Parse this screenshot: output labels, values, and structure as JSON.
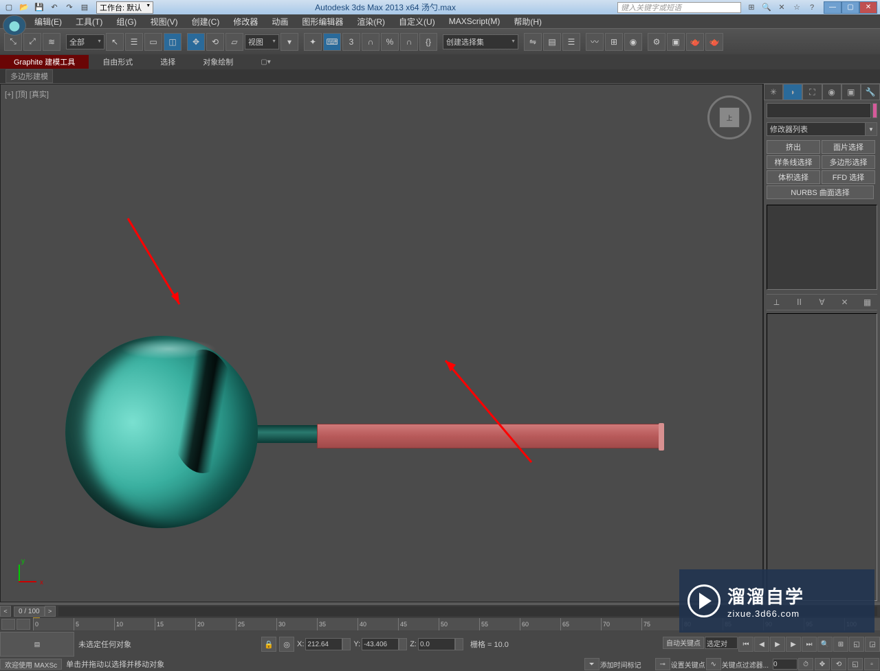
{
  "titlebar": {
    "workspace_label": "工作台: 默认",
    "app_title": "Autodesk 3ds Max  2013 x64     汤勺.max",
    "search_placeholder": "键入关键字或短语"
  },
  "menus": [
    "编辑(E)",
    "工具(T)",
    "组(G)",
    "视图(V)",
    "创建(C)",
    "修改器",
    "动画",
    "图形编辑器",
    "渲染(R)",
    "自定义(U)",
    "MAXScript(M)",
    "帮助(H)"
  ],
  "toolbar": {
    "filter": "全部",
    "refcoord": "视图",
    "named_sel": "创建选择集"
  },
  "ribbon": {
    "tabs": [
      "Graphite 建模工具",
      "自由形式",
      "选择",
      "对象绘制"
    ],
    "sub": "多边形建模"
  },
  "viewport": {
    "label": "[+] [顶] [真实]",
    "cube": "上"
  },
  "cmdpanel": {
    "modifier_list": "修改器列表",
    "buttons": [
      "挤出",
      "面片选择",
      "样条线选择",
      "多边形选择",
      "体积选择",
      "FFD 选择"
    ],
    "nurbs": "NURBS 曲面选择"
  },
  "timeline": {
    "frame": "0 / 100",
    "ticks": [
      "0",
      "5",
      "10",
      "15",
      "20",
      "25",
      "30",
      "35",
      "40",
      "45",
      "50",
      "55",
      "60",
      "65",
      "70",
      "75",
      "80",
      "85",
      "90",
      "95",
      "100"
    ]
  },
  "status": {
    "selection": "未选定任何对象",
    "x": "212.64",
    "y": "-43.406",
    "z": "0.0",
    "grid": "栅格 = 10.0",
    "auto_key": "自动关键点",
    "sel_lock": "选定对",
    "welcome": "欢迎使用  MAXSc",
    "hint": "单击并拖动以选择并移动对象",
    "add_time": "添加时间标记",
    "set_key": "设置关键点",
    "key_filter": "关键点过滤器..."
  },
  "watermark": {
    "cn": "溜溜自学",
    "en": "zixue.3d66.com"
  }
}
